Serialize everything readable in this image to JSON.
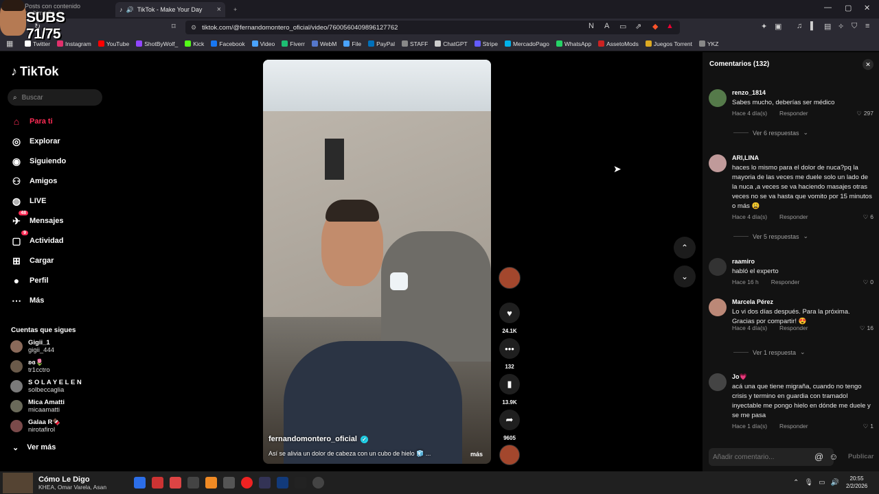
{
  "browser": {
    "tabs": [
      {
        "label": "Posts con contenido multimedia d",
        "active": false
      },
      {
        "label": "TikTok - Make Your Day",
        "active": true
      }
    ],
    "url": "tiktok.com/@fernandomontero_oficial/video/7600560409896127762",
    "bookmarks": [
      {
        "label": "Twitter",
        "color": "#ffffff"
      },
      {
        "label": "Instagram",
        "color": "#e1306c"
      },
      {
        "label": "YouTube",
        "color": "#ff0000"
      },
      {
        "label": "ShotByWolf_",
        "color": "#9146ff"
      },
      {
        "label": "Kick",
        "color": "#53fc18"
      },
      {
        "label": "Facebook",
        "color": "#1877f2"
      },
      {
        "label": "Video",
        "color": "#4aa3ff"
      },
      {
        "label": "Fiverr",
        "color": "#1dbf73"
      },
      {
        "label": "WebM",
        "color": "#5577cc"
      },
      {
        "label": "File",
        "color": "#4aa3ff"
      },
      {
        "label": "PayPal",
        "color": "#0070ba"
      },
      {
        "label": "STAFF",
        "color": "#888888"
      },
      {
        "label": "ChatGPT",
        "color": "#cccccc"
      },
      {
        "label": "Stripe",
        "color": "#635bff"
      },
      {
        "label": "MercadoPago",
        "color": "#00b1ea"
      },
      {
        "label": "WhatsApp",
        "color": "#25d366"
      },
      {
        "label": "AssetoMods",
        "color": "#cc2222"
      },
      {
        "label": "Juegos Torrent",
        "color": "#ddaa22"
      },
      {
        "label": "YKZ",
        "color": "#888888"
      }
    ]
  },
  "overlay": {
    "subs": "SUBS 71/75"
  },
  "sidebar": {
    "logo": "TikTok",
    "search_placeholder": "Buscar",
    "nav": [
      {
        "label": "Para ti",
        "icon": "home-icon",
        "active": true
      },
      {
        "label": "Explorar",
        "icon": "compass-icon"
      },
      {
        "label": "Siguiendo",
        "icon": "following-icon"
      },
      {
        "label": "Amigos",
        "icon": "friends-icon"
      },
      {
        "label": "LIVE",
        "icon": "live-icon"
      },
      {
        "label": "Mensajes",
        "icon": "messages-icon",
        "badge": "48"
      },
      {
        "label": "Actividad",
        "icon": "activity-icon",
        "badge": "9"
      },
      {
        "label": "Cargar",
        "icon": "upload-icon"
      },
      {
        "label": "Perfil",
        "icon": "profile-icon"
      },
      {
        "label": "Más",
        "icon": "more-icon"
      }
    ],
    "following_heading": "Cuentas que sigues",
    "accounts": [
      {
        "name": "Gigii_1",
        "user": "gigii_444"
      },
      {
        "name": "ʚɞ🌷",
        "user": "tr1cctro"
      },
      {
        "name": "S O L A Y E L E N",
        "user": "solbeccaglia"
      },
      {
        "name": "Mica Amatti",
        "user": "micaamatti"
      },
      {
        "name": "Galaa R🍫",
        "user": "nirotafirol"
      }
    ],
    "see_more": "Ver más"
  },
  "video": {
    "author": "fernandomontero_oficial",
    "description": "Así se alivia un dolor de cabeza con un cubo de hielo 🧊 ...",
    "more": "más"
  },
  "actions": {
    "likes": "24.1K",
    "comments": "132",
    "saves": "13.9K",
    "shares": "9605"
  },
  "comments": {
    "title": "Comentarios",
    "count": "(132)",
    "items": [
      {
        "user": "renzo_1814",
        "text": "Sabes mucho, deberías ser médico",
        "time": "Hace 4 día(s)",
        "reply": "Responder",
        "likes": "297",
        "replies": "Ver 6 respuestas"
      },
      {
        "user": "ARI,LINA",
        "text": "haces lo mismo para el dolor de nuca?pq la mayoria de las veces me duele solo un lado de la nuca ,a veces se va haciendo masajes otras veces no se va hasta que vomito por 15 minutos o más 😩",
        "time": "Hace 4 día(s)",
        "reply": "Responder",
        "likes": "6",
        "replies": "Ver 5 respuestas"
      },
      {
        "user": "raamiro",
        "text": "habló el experto",
        "time": "Hace 16 h",
        "reply": "Responder",
        "likes": "0"
      },
      {
        "user": "Marcela Pérez",
        "text": "Lo vi dos días después. Para la próxima. Gracias por compartir! 😍",
        "time": "Hace 4 día(s)",
        "reply": "Responder",
        "likes": "16",
        "replies": "Ver 1 respuesta"
      },
      {
        "user": "Jo💗",
        "text": "acá una que tiene migraña, cuando no tengo crisis y termino en guardia con tramadol inyectable me pongo hielo en dónde me duele y se me pasa",
        "time": "Hace 1 día(s)",
        "reply": "Responder",
        "likes": "1"
      }
    ],
    "input_placeholder": "Añadir comentario...",
    "publish": "Publicar"
  },
  "taskbar": {
    "song_title": "Cómo Le Digo",
    "song_artist": "KHEA, Omar Varela, Asan",
    "time": "20:55",
    "date": "2/2/2026"
  }
}
